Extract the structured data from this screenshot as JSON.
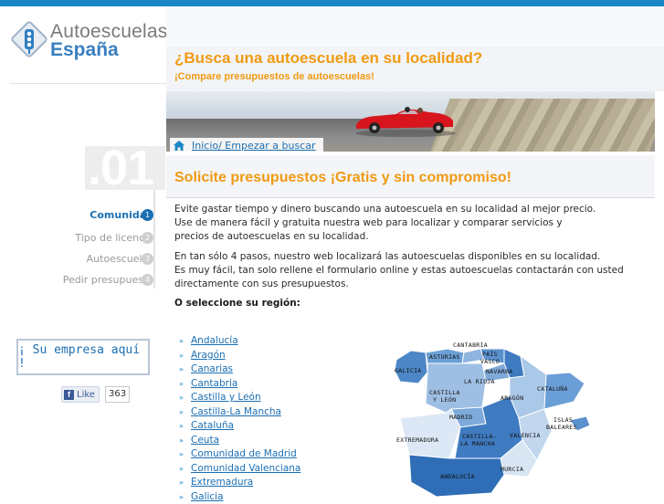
{
  "logo": {
    "title": "Autoescuelas",
    "subtitle": "España"
  },
  "header": {
    "title": "¿Busca una autoescuela en su localidad?",
    "subtitle": "¡Compare presupuestos de autoescuelas!"
  },
  "breadcrumb": {
    "label": "Inicio/ Empezar a buscar"
  },
  "steps": {
    "number": ".01",
    "items": [
      {
        "label": "Comunidad",
        "num": "1"
      },
      {
        "label": "Tipo de licencia",
        "num": "2"
      },
      {
        "label": "Autoescuelas",
        "num": "3"
      },
      {
        "label": "Pedir presupuesto",
        "num": "4"
      }
    ]
  },
  "ad": {
    "label": "¡ Su empresa aquí !"
  },
  "facebook": {
    "like_label": "Like",
    "count": "363"
  },
  "section": {
    "title": "Solicite presupuestos ¡Gratis y sin compromiso!",
    "paragraphs": [
      "Evite gastar tiempo y dinero buscando una autoescuela en su localidad al mejor precio.",
      "Use de manera fácil y gratuita nuestra web para localizar y comparar servicios y",
      "precios de autoescuelas en su localidad.",
      "En tan sólo 4 pasos, nuestro web localizará las autoescuelas disponibles en su localidad.",
      "Es muy fácil, tan solo rellene el formulario online y estas autoescuelas contactarán con usted",
      "directamente con sus presupuestos."
    ],
    "region_label": "O seleccione su región:"
  },
  "regions": [
    "Andalucía",
    "Aragón",
    "Canarias",
    "Cantabria",
    "Castilla y León",
    "Castilla-La Mancha",
    "Cataluña",
    "Ceuta",
    "Comunidad de Madrid",
    "Comunidad Valenciana",
    "Extremadura",
    "Galicia"
  ],
  "map": {
    "labels": {
      "cantabria": "CANTABRIA",
      "asturias": "ASTURIAS",
      "pais_vasco_1": "PAÍS",
      "pais_vasco_2": "VASCO",
      "galicia": "GALICIA",
      "navarra": "NAVARRA",
      "la_rioja": "LA RIOJA",
      "castilla_leon_1": "CASTILLA",
      "castilla_leon_2": "Y LEÓN",
      "aragon": "ARAGÓN",
      "cataluna": "CATALUÑA",
      "madrid": "MADRID",
      "islas_baleares_1": "ISLAS",
      "islas_baleares_2": "BALEARES",
      "extremadura": "EXTREMADURA",
      "castilla_mancha_1": "CASTILLA-",
      "castilla_mancha_2": "LA MANCHA",
      "valencia": "VALENCIA",
      "murcia": "MURCIA",
      "andalucia": "ANDALUCÍA"
    }
  },
  "colors": {
    "accent_blue": "#1b86c6",
    "link_blue": "#1b6fb3",
    "title_orange": "#f09a12"
  }
}
